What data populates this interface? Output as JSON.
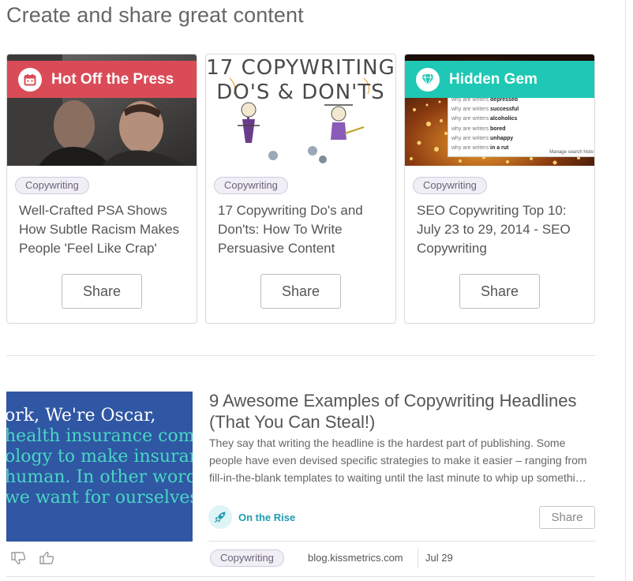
{
  "page": {
    "title": "Create and share great content"
  },
  "cards": [
    {
      "banner": "Hot Off the Press",
      "banner_icon": "calendar-icon",
      "banner_color": "#d94c57",
      "tag": "Copywriting",
      "title": "Well-Crafted PSA Shows How Subtle Racism Makes People 'Feel Like Crap'",
      "share_label": "Share"
    },
    {
      "thumb_line1": "17 COPYWRITING",
      "thumb_line2": "DO'S & DON'TS",
      "tag": "Copywriting",
      "title": "17 Copywriting Do's and Don'ts: How To Write Persuasive Content",
      "share_label": "Share"
    },
    {
      "banner": "Hidden Gem",
      "banner_icon": "gem-icon",
      "banner_color": "#1ec8b4",
      "search_suggestions": [
        {
          "prefix": "why are writers",
          "term": "depressed"
        },
        {
          "prefix": "why are writers",
          "term": "successful"
        },
        {
          "prefix": "why are writers",
          "term": "alcoholics"
        },
        {
          "prefix": "why are writers",
          "term": "bored"
        },
        {
          "prefix": "why are writers",
          "term": "unhappy"
        },
        {
          "prefix": "why are writers",
          "term": "in a rut"
        }
      ],
      "search_footer": "Manage search histo",
      "tag": "Copywriting",
      "title": "SEO Copywriting Top 10: July 23 to 29, 2014 - SEO Copywriting",
      "share_label": "Share"
    }
  ],
  "article": {
    "image_lines": [
      "ork, We're Oscar,",
      "health insurance com",
      "ology to make insuran",
      "human. In other words",
      "we want for ourselves"
    ],
    "title": "9 Awesome Examples of Copywriting Headlines (That You Can Steal!)",
    "desc_line1": "They say that writing the headline is the hardest part of publishing. Some",
    "desc_line2": "people have even devised specific strategies to make it easier – ranging from",
    "desc_line3": "fill-in-the-blank templates to waiting until the last minute to whip up somethi…",
    "badge": "On the Rise",
    "badge_icon": "rocket-icon",
    "share_label": "Share",
    "tag": "Copywriting",
    "domain": "blog.kissmetrics.com",
    "date": "Jul 29"
  },
  "colors": {
    "hot": "#d94c57",
    "gem": "#1ec8b4",
    "rise": "#1f9bb0",
    "tag_bg": "#f1eff6"
  }
}
